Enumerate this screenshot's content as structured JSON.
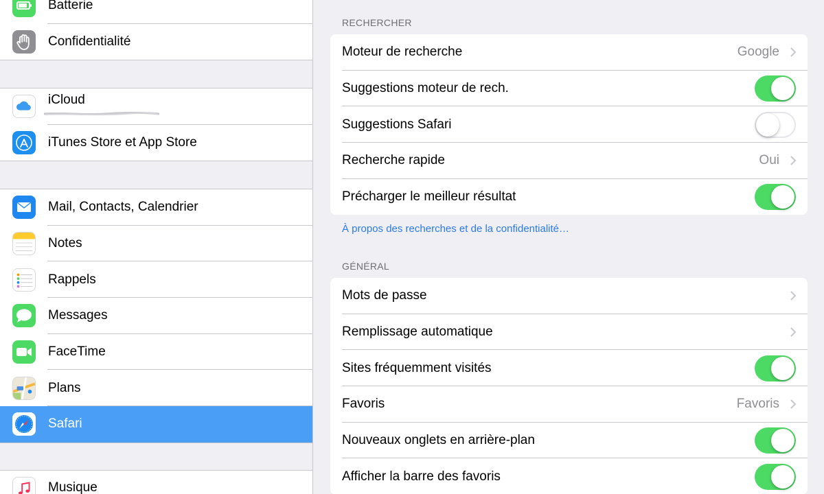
{
  "sidebar": {
    "groups": [
      {
        "items": [
          {
            "label": "Batterie",
            "icon": "battery-icon"
          },
          {
            "label": "Confidentialité",
            "icon": "hand-icon"
          }
        ]
      },
      {
        "items": [
          {
            "label": "iCloud",
            "icon": "icloud-icon"
          },
          {
            "label": "iTunes Store et App Store",
            "icon": "app-store-icon"
          }
        ]
      },
      {
        "items": [
          {
            "label": "Mail, Contacts, Calendrier",
            "icon": "mail-icon"
          },
          {
            "label": "Notes",
            "icon": "notes-icon"
          },
          {
            "label": "Rappels",
            "icon": "reminders-icon"
          },
          {
            "label": "Messages",
            "icon": "messages-icon"
          },
          {
            "label": "FaceTime",
            "icon": "facetime-icon"
          },
          {
            "label": "Plans",
            "icon": "maps-icon"
          },
          {
            "label": "Safari",
            "icon": "safari-icon",
            "selected": true
          }
        ]
      },
      {
        "items": [
          {
            "label": "Musique",
            "icon": "music-icon"
          }
        ]
      }
    ]
  },
  "detail": {
    "search": {
      "header": "RECHERCHER",
      "rows": [
        {
          "label": "Moteur de recherche",
          "value": "Google",
          "type": "disclosure"
        },
        {
          "label": "Suggestions moteur de rech.",
          "type": "toggle",
          "on": true
        },
        {
          "label": "Suggestions Safari",
          "type": "toggle",
          "on": false
        },
        {
          "label": "Recherche rapide",
          "value": "Oui",
          "type": "disclosure"
        },
        {
          "label": "Précharger le meilleur résultat",
          "type": "toggle",
          "on": true
        }
      ],
      "footer": "À propos des recherches et de la confidentialité…"
    },
    "general": {
      "header": "GÉNÉRAL",
      "rows": [
        {
          "label": "Mots de passe",
          "value": "",
          "type": "disclosure"
        },
        {
          "label": "Remplissage automatique",
          "value": "",
          "type": "disclosure"
        },
        {
          "label": "Sites fréquemment visités",
          "type": "toggle",
          "on": true
        },
        {
          "label": "Favoris",
          "value": "Favoris",
          "type": "disclosure"
        },
        {
          "label": "Nouveaux onglets en arrière-plan",
          "type": "toggle",
          "on": true
        },
        {
          "label": "Afficher la barre des favoris",
          "type": "toggle",
          "on": true
        }
      ]
    }
  },
  "colors": {
    "selection": "#4a9ef6",
    "toggle_on": "#4cd964",
    "link": "#2b7ae8",
    "background": "#efeff4"
  }
}
